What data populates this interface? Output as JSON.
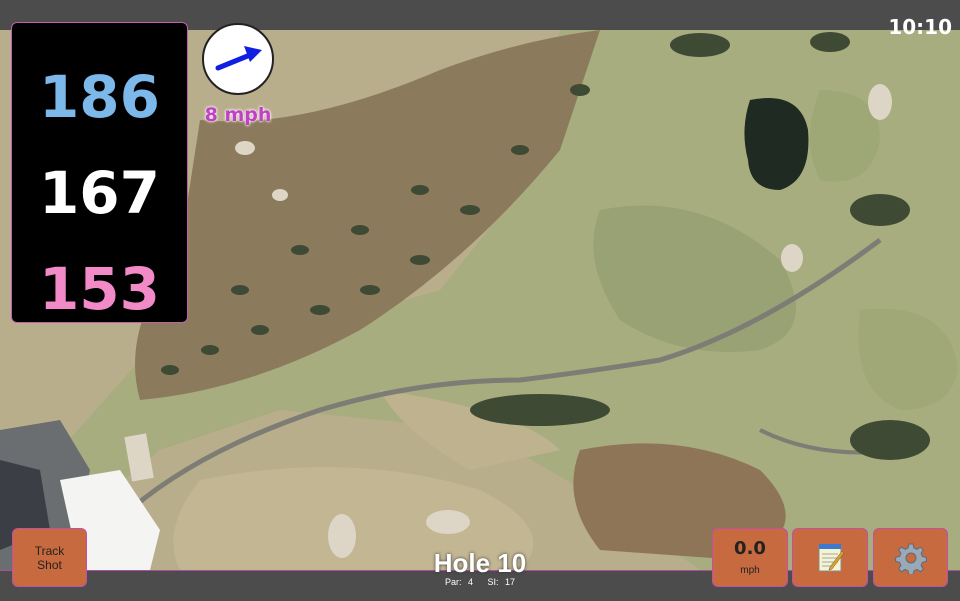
{
  "status_bar": {
    "time": "10:10"
  },
  "distances": {
    "back": "186",
    "center": "167",
    "front": "153"
  },
  "wind": {
    "speed_text": "8 mph",
    "icon": "wind-direction-arrow-icon"
  },
  "buttons": {
    "track_shot_line1": "Track",
    "track_shot_line2": "Shot",
    "speed_value": "0.0",
    "speed_unit": "mph",
    "notes_icon": "notepad-icon",
    "settings_icon": "gear-icon"
  },
  "hole": {
    "title": "Hole 10",
    "par_text": "Par: 4",
    "si_text": "SI: 17"
  },
  "colors": {
    "accent_border": "#c050a8",
    "button_bg": "#c86a3f",
    "back_distance": "#7db8ea",
    "front_distance": "#f28ac8",
    "wind_text": "#c23fc7"
  }
}
